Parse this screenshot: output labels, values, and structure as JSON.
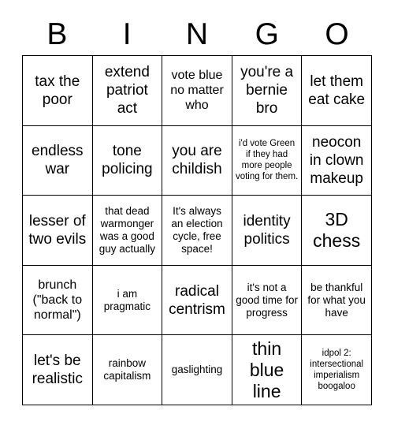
{
  "header": {
    "letters": [
      "B",
      "I",
      "N",
      "G",
      "O"
    ]
  },
  "colors": {
    "background": "#ffffff",
    "text": "#000000",
    "grid_line": "#000000"
  },
  "grid": {
    "rows": 5,
    "columns": 5,
    "cells": [
      {
        "text": "tax the poor",
        "size": "lg"
      },
      {
        "text": "extend patriot act",
        "size": "lg"
      },
      {
        "text": "vote blue no matter who",
        "size": "md"
      },
      {
        "text": "you're a bernie bro",
        "size": "lg"
      },
      {
        "text": "let them eat cake",
        "size": "lg"
      },
      {
        "text": "endless war",
        "size": "lg"
      },
      {
        "text": "tone policing",
        "size": "lg"
      },
      {
        "text": "you are childish",
        "size": "lg"
      },
      {
        "text": "i'd vote Green if they had more people voting for them.",
        "size": "xs"
      },
      {
        "text": "neocon in clown makeup",
        "size": "lg"
      },
      {
        "text": "lesser of two evils",
        "size": "lg"
      },
      {
        "text": "that dead warmonger was a good guy actually",
        "size": "sm"
      },
      {
        "text": "It's always an election cycle, free space!",
        "size": "sm"
      },
      {
        "text": "identity politics",
        "size": "lg"
      },
      {
        "text": "3D chess",
        "size": "xl"
      },
      {
        "text": "brunch (\"back to normal\")",
        "size": "md"
      },
      {
        "text": "i am pragmatic",
        "size": "sm"
      },
      {
        "text": "radical centrism",
        "size": "lg"
      },
      {
        "text": "it's not a good time for progress",
        "size": "sm"
      },
      {
        "text": "be thankful for what you have",
        "size": "sm"
      },
      {
        "text": "let's be realistic",
        "size": "lg"
      },
      {
        "text": "rainbow capitalism",
        "size": "sm"
      },
      {
        "text": "gaslighting",
        "size": "sm"
      },
      {
        "text": "thin blue line",
        "size": "xl"
      },
      {
        "text": "idpol 2: intersectional imperialism boogaloo",
        "size": "xs"
      }
    ]
  }
}
